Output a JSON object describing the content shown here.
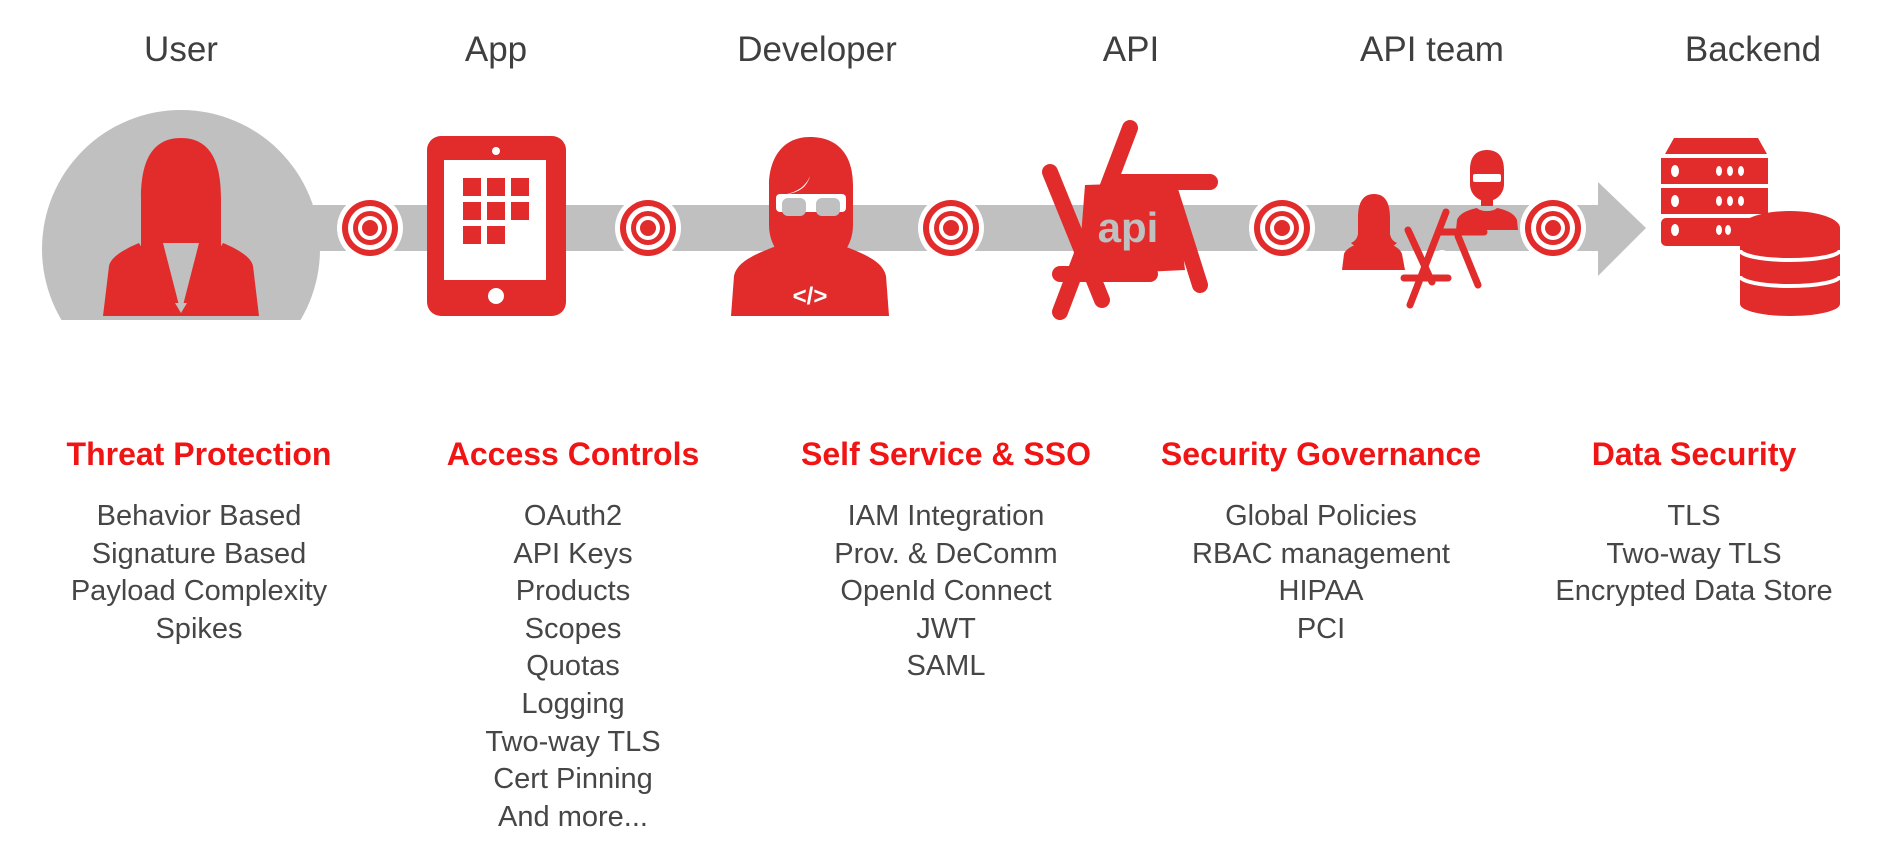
{
  "colors": {
    "accent": "#e22b2b",
    "band": "#c0c0c0",
    "title": "#f01414",
    "text": "#464646"
  },
  "stages": [
    {
      "label": "User",
      "icon": "woman-user-icon"
    },
    {
      "label": "App",
      "icon": "tablet-app-icon"
    },
    {
      "label": "Developer",
      "icon": "developer-icon"
    },
    {
      "label": "API",
      "icon": "api-logo-icon"
    },
    {
      "label": "API team",
      "icon": "api-team-icon"
    },
    {
      "label": "Backend",
      "icon": "server-database-icon"
    }
  ],
  "sections": [
    {
      "title": "Threat Protection",
      "items": [
        "Behavior Based",
        "Signature Based",
        "Payload Complexity",
        "Spikes"
      ]
    },
    {
      "title": "Access Controls",
      "items": [
        "OAuth2",
        "API Keys",
        "Products",
        "Scopes",
        "Quotas",
        "Logging",
        "Two-way TLS",
        "Cert Pinning",
        "And more..."
      ]
    },
    {
      "title": "Self Service & SSO",
      "items": [
        "IAM Integration",
        "Prov. & DeComm",
        "OpenId Connect",
        "JWT",
        "SAML"
      ]
    },
    {
      "title": "Security Governance",
      "items": [
        "Global Policies",
        "RBAC management",
        "HIPAA",
        "PCI"
      ]
    },
    {
      "title": "Data Security",
      "items": [
        "TLS",
        "Two-way TLS",
        "Encrypted Data Store"
      ]
    }
  ],
  "api_logo_text": "api"
}
